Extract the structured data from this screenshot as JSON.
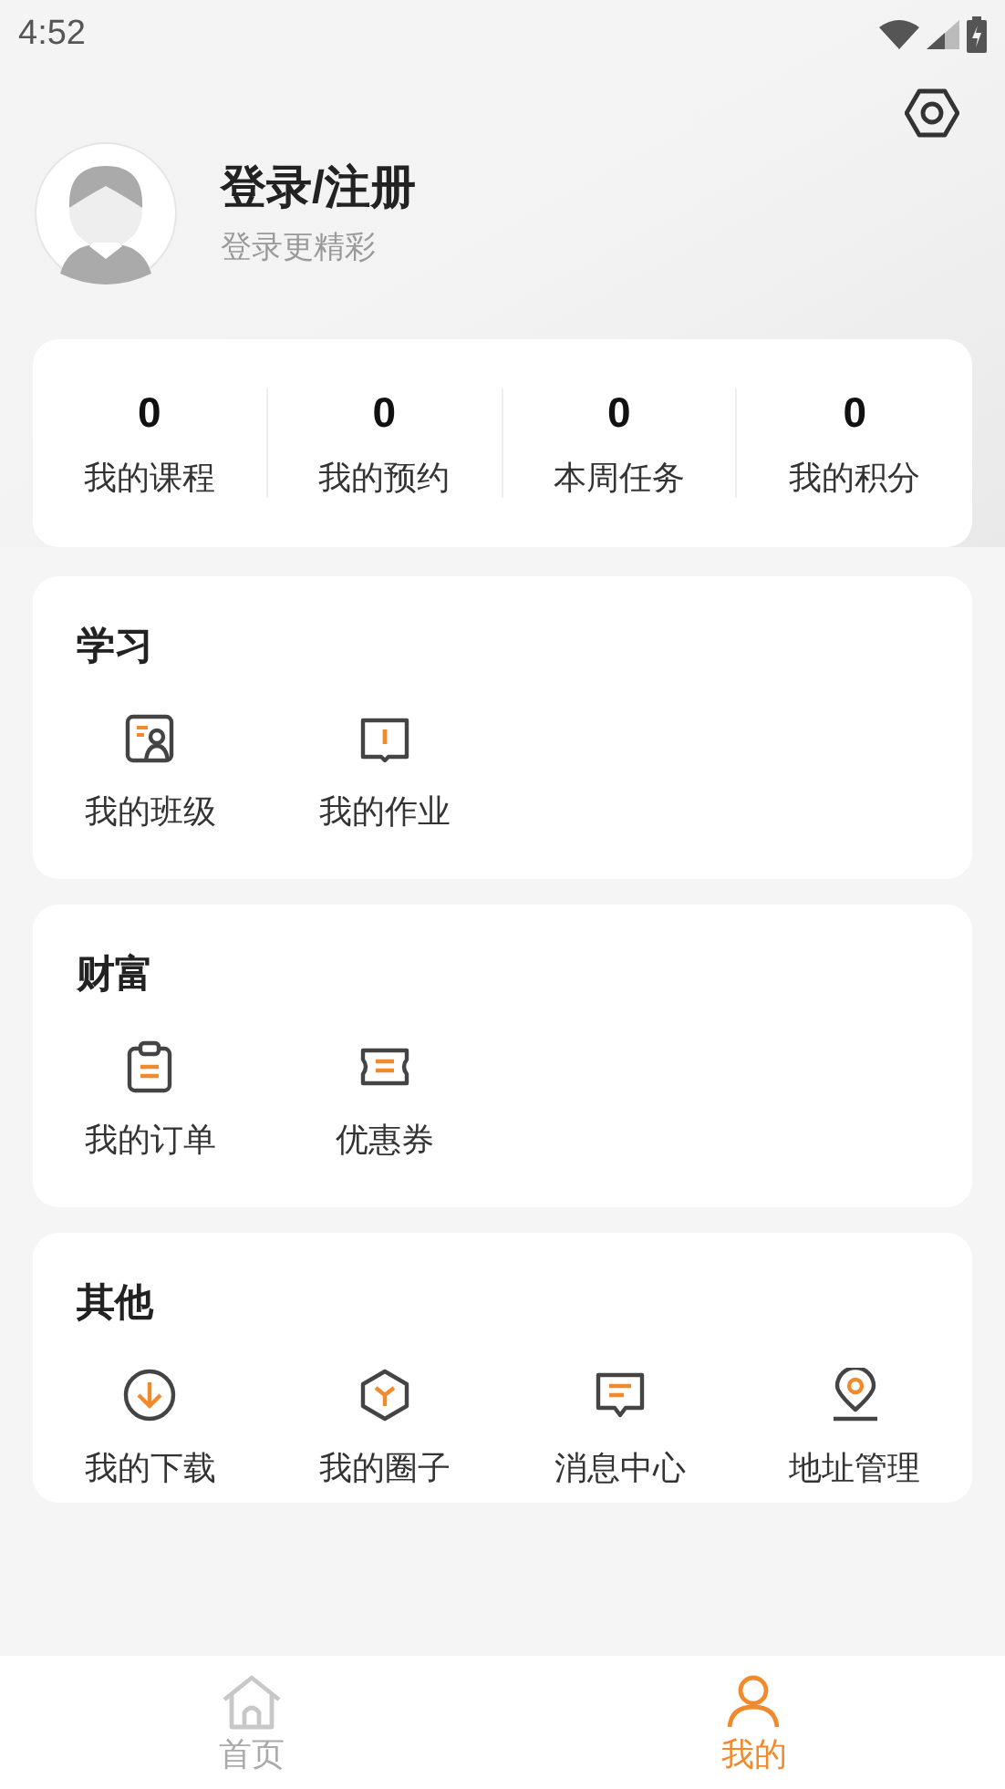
{
  "status_bar": {
    "time": "4:52"
  },
  "profile": {
    "title": "登录/注册",
    "subtitle": "登录更精彩"
  },
  "stats": [
    {
      "value": "0",
      "label": "我的课程"
    },
    {
      "value": "0",
      "label": "我的预约"
    },
    {
      "value": "0",
      "label": "本周任务"
    },
    {
      "value": "0",
      "label": "我的积分"
    }
  ],
  "sections": [
    {
      "title": "学习",
      "items": [
        {
          "label": "我的班级"
        },
        {
          "label": "我的作业"
        }
      ]
    },
    {
      "title": "财富",
      "items": [
        {
          "label": "我的订单"
        },
        {
          "label": "优惠券"
        }
      ]
    },
    {
      "title": "其他",
      "items": [
        {
          "label": "我的下载"
        },
        {
          "label": "我的圈子"
        },
        {
          "label": "消息中心"
        },
        {
          "label": "地址管理"
        }
      ]
    }
  ],
  "bottom_nav": [
    {
      "label": "首页",
      "selected": false
    },
    {
      "label": "我的",
      "selected": true
    }
  ]
}
